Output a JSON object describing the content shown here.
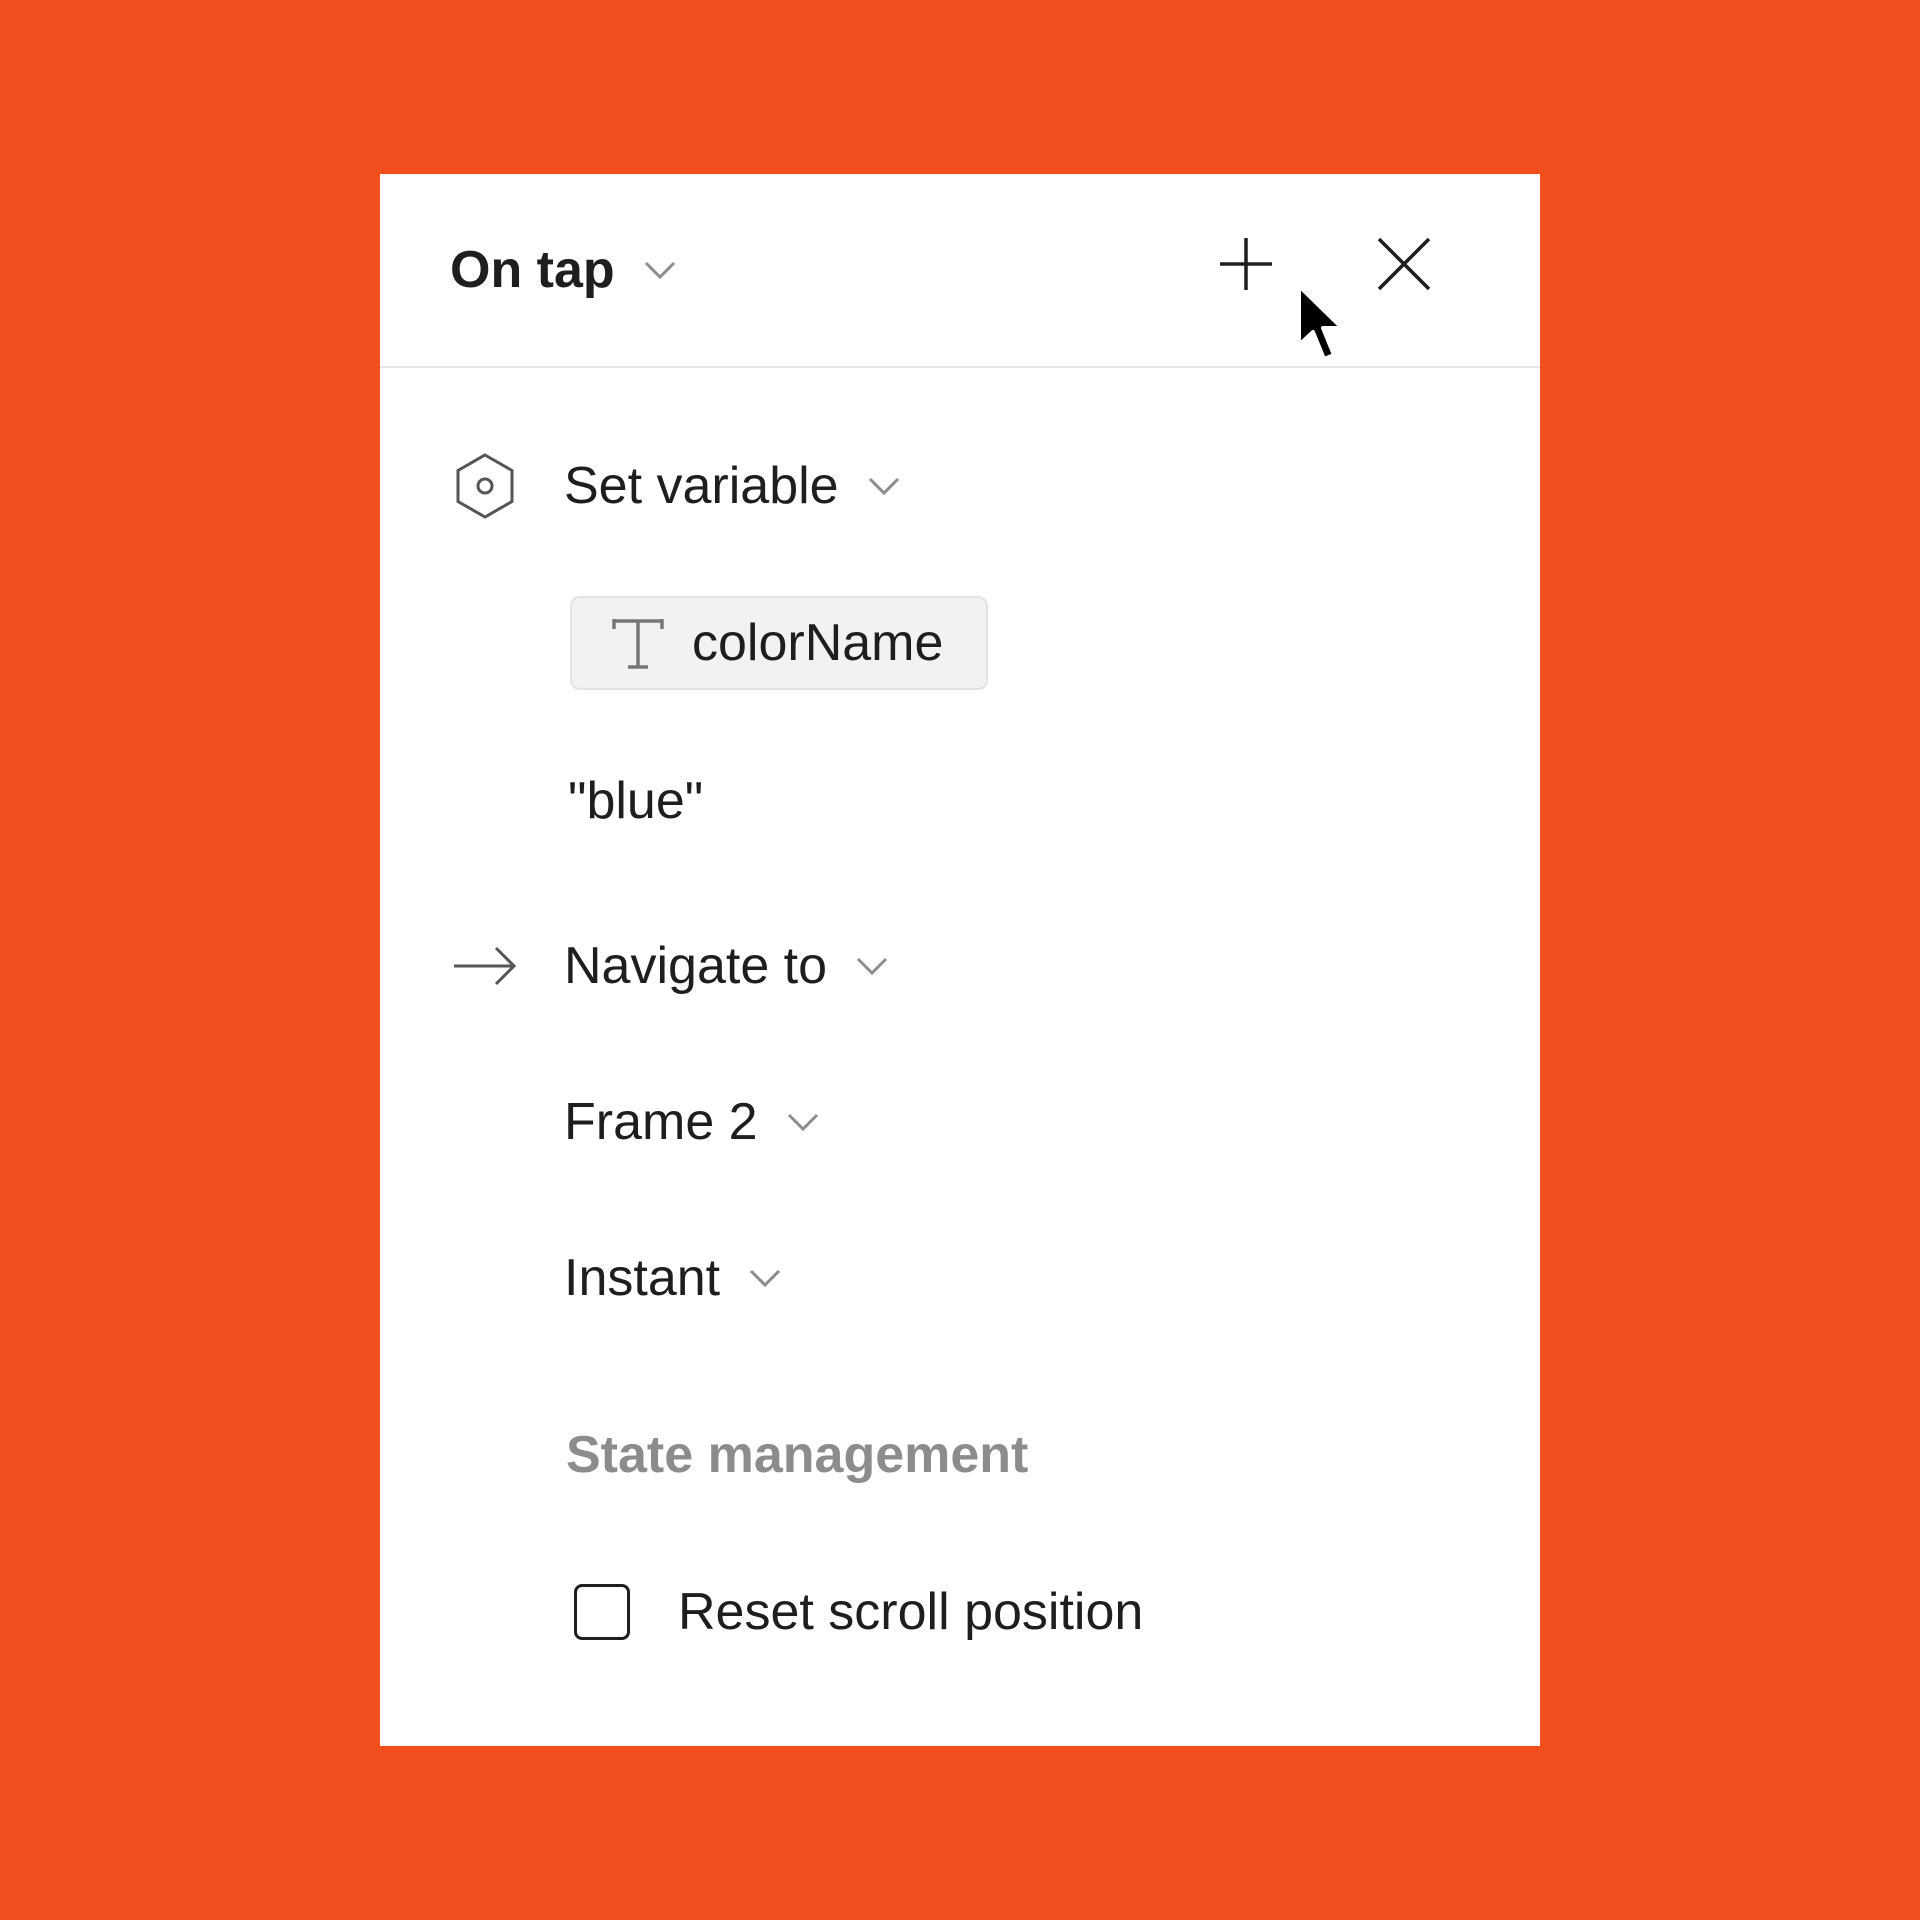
{
  "header": {
    "trigger_label": "On tap"
  },
  "actions": [
    {
      "icon": "variable-hexagon-icon",
      "label": "Set variable",
      "variable_chip": {
        "icon": "text-type-icon",
        "label": "colorName"
      },
      "value": "\"blue\""
    },
    {
      "icon": "arrow-right-icon",
      "label": "Navigate to",
      "destination": "Frame 2",
      "transition": "Instant",
      "state_management": {
        "title": "State management",
        "reset_scroll_label": "Reset scroll position",
        "reset_scroll_checked": false
      }
    }
  ],
  "colors": {
    "background": "#F24E1E",
    "panel": "#FFFFFF",
    "text": "#1E1E1E",
    "muted_text": "#8C8C8C"
  }
}
